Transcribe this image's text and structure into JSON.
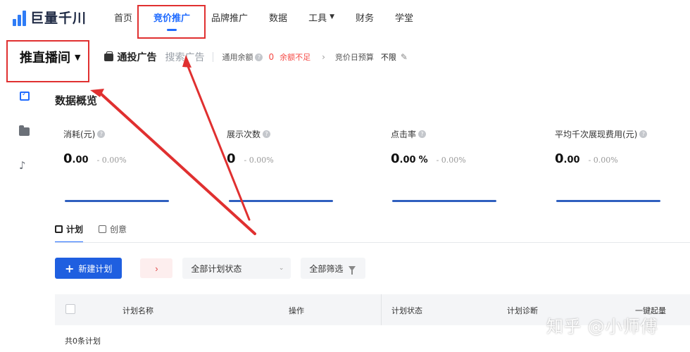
{
  "brand": {
    "name": "巨量千川",
    "color": "#2f7cf6"
  },
  "nav": {
    "items": [
      {
        "label": "首页",
        "active": false
      },
      {
        "label": "竞价推广",
        "active": true
      },
      {
        "label": "品牌推广",
        "active": false
      },
      {
        "label": "数据",
        "active": false
      },
      {
        "label": "工具",
        "active": false,
        "dropdown": true
      },
      {
        "label": "财务",
        "active": false
      },
      {
        "label": "学堂",
        "active": false
      }
    ],
    "accent": "#1f6bff"
  },
  "subbar": {
    "account_select": "推直播间",
    "ad_type_active": "通投广告",
    "ad_type_alt": "搜索广告",
    "balance_label": "通用余额",
    "balance_value": "0",
    "balance_warning": "余额不足",
    "budget_label": "竞价日预算",
    "budget_value": "不限"
  },
  "rail": {
    "icons": [
      "calendar-check-icon",
      "folder-icon",
      "tiktok-icon"
    ]
  },
  "overview": {
    "title": "数据概览",
    "metrics": [
      {
        "label": "消耗(元)",
        "int": "0",
        "dec": ".00",
        "unit": "",
        "delta": "- 0.00%"
      },
      {
        "label": "展示次数",
        "int": "0",
        "dec": "",
        "unit": "",
        "delta": "- 0.00%"
      },
      {
        "label": "点击率",
        "int": "0",
        "dec": ".00",
        "unit": "%",
        "delta": "- 0.00%"
      },
      {
        "label": "平均千次展现费用(元)",
        "int": "0",
        "dec": ".00",
        "unit": "",
        "delta": "- 0.00%"
      }
    ]
  },
  "tabs": [
    {
      "label": "计划",
      "active": true
    },
    {
      "label": "创意",
      "active": false
    }
  ],
  "toolbar": {
    "new_plan": "新建计划",
    "status_select": "全部计划状态",
    "filter": "全部筛选"
  },
  "table": {
    "columns": [
      "计划名称",
      "操作",
      "计划状态",
      "计划诊断",
      "一键起量"
    ],
    "footer": "共0条计划"
  },
  "watermark": "知乎 @小师傅",
  "annotation_color": "#e03030"
}
